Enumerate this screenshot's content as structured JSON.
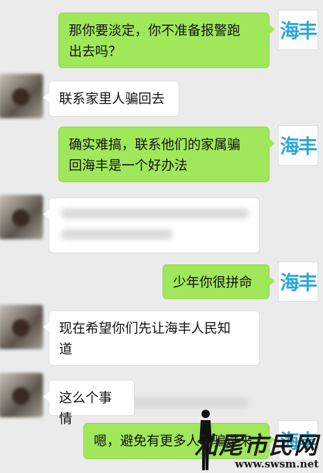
{
  "messages": [
    {
      "side": "right",
      "text": "那你要淡定，你不准备报警跑\n出去吗？"
    },
    {
      "side": "left",
      "text": "联系家里人骗回去"
    },
    {
      "side": "right",
      "text": "确实难搞，联系他们的家属骗\n回海丰是一个好办法"
    },
    {
      "side": "left",
      "text": ""
    },
    {
      "side": "right",
      "text": "少年你很拼命"
    },
    {
      "side": "left",
      "text": "现在希望你们先让海丰人民知\n道"
    },
    {
      "side": "left",
      "text": "这么个事情"
    },
    {
      "side": "right",
      "text": "嗯，避免有更多人被骗过来"
    }
  ],
  "avatar_right_label": "海丰",
  "watermark": {
    "title": "汕尾市民网",
    "url": "www.swsm.net"
  },
  "colors": {
    "bubble_green": "#a0e75a",
    "background": "#ebebeb",
    "brand_blue": "#2aa8d8"
  }
}
